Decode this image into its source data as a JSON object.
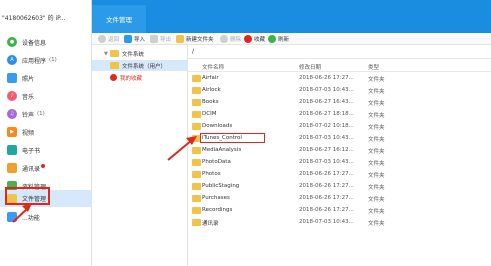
{
  "device": {
    "name": "\"4180062603\" 的 iP..."
  },
  "header": {
    "active_tab": "文件管理"
  },
  "sidebar": {
    "items": [
      {
        "label": "设备信息",
        "count": "",
        "color": "#39b54a"
      },
      {
        "label": "应用程序",
        "count": "(1)",
        "color": "#2d8ef0"
      },
      {
        "label": "照片",
        "count": "",
        "color": "#3a9bf3"
      },
      {
        "label": "音乐",
        "count": "",
        "color": "#f05b72"
      },
      {
        "label": "铃声",
        "count": "(1)",
        "color": "#aa66dd"
      },
      {
        "label": "视频",
        "count": "",
        "color": "#f58a1f"
      },
      {
        "label": "电子书",
        "count": "",
        "color": "#20a8a0"
      },
      {
        "label": "通讯录",
        "count": "",
        "color": "#f0a030"
      },
      {
        "label": "资料管理",
        "count": "",
        "color": "#4caf50"
      },
      {
        "label": "文件管理",
        "count": "",
        "color": "#f2c34a"
      },
      {
        "label": "...功能",
        "count": "",
        "color": "#3a9bf3"
      }
    ]
  },
  "toolbar": {
    "back": "返回",
    "import": "导入",
    "export": "导出",
    "new_folder": "新建文件夹",
    "delete": "删除",
    "favorite": "收藏",
    "refresh": "刷新"
  },
  "tree": {
    "root": "文件系统",
    "user": "文件系统（用户）",
    "favorites": "我的收藏"
  },
  "path": {
    "current": "/"
  },
  "table": {
    "headers": {
      "name": "文件名称",
      "date": "修改日期",
      "type": "类型"
    },
    "rows": [
      {
        "name": "Airfair",
        "date": "2018-06-26 17:27...",
        "type": "文件夹"
      },
      {
        "name": "Airlock",
        "date": "2018-07-03 10:43...",
        "type": "文件夹"
      },
      {
        "name": "Books",
        "date": "2018-06-27 16:43...",
        "type": "文件夹"
      },
      {
        "name": "DCIM",
        "date": "2018-06-27 18:18...",
        "type": "文件夹"
      },
      {
        "name": "Downloads",
        "date": "2018-07-02 10:18...",
        "type": "文件夹"
      },
      {
        "name": "iTunes_Control",
        "date": "2018-07-03 10:43...",
        "type": "文件夹"
      },
      {
        "name": "MediaAnalysis",
        "date": "2018-06-27 16:12...",
        "type": "文件夹"
      },
      {
        "name": "PhotoData",
        "date": "2018-07-03 10:43...",
        "type": "文件夹"
      },
      {
        "name": "Photos",
        "date": "2018-06-26 17:27...",
        "type": "文件夹"
      },
      {
        "name": "PublicStaging",
        "date": "2018-06-26 17:27...",
        "type": "文件夹"
      },
      {
        "name": "Purchases",
        "date": "2018-06-26 17:27...",
        "type": "文件夹"
      },
      {
        "name": "Recordings",
        "date": "2018-06-26 17:27...",
        "type": "文件夹"
      },
      {
        "name": "通讯录",
        "date": "2018-07-03 10:43...",
        "type": "文件夹"
      }
    ]
  }
}
